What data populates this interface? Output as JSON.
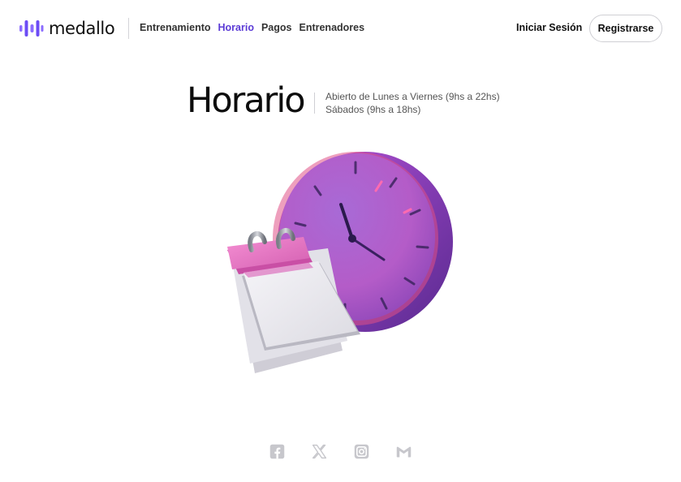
{
  "brand": {
    "name": "medallo",
    "logo_icon": "equalizer-bars-icon",
    "accent": "#6c4cf5"
  },
  "nav": {
    "links": [
      {
        "label": "Entrenamiento",
        "active": false
      },
      {
        "label": "Horario",
        "active": true
      },
      {
        "label": "Pagos",
        "active": false
      },
      {
        "label": "Entrenadores",
        "active": false
      }
    ],
    "login_label": "Iniciar Sesión",
    "register_label": "Registrarse"
  },
  "hero": {
    "title": "Horario",
    "hours_weekdays": "Abierto de Lunes a Viernes (9hs a 22hs)",
    "hours_saturday": "Sábados (9hs a 18hs)",
    "illustration": [
      "clock-icon",
      "calendar-icon"
    ]
  },
  "social": [
    "facebook-icon",
    "x-icon",
    "instagram-icon",
    "gmail-icon"
  ],
  "colors": {
    "active_link": "#5b3bd6",
    "clock": "#a455c7",
    "calendar_pink": "#e77ac3"
  }
}
